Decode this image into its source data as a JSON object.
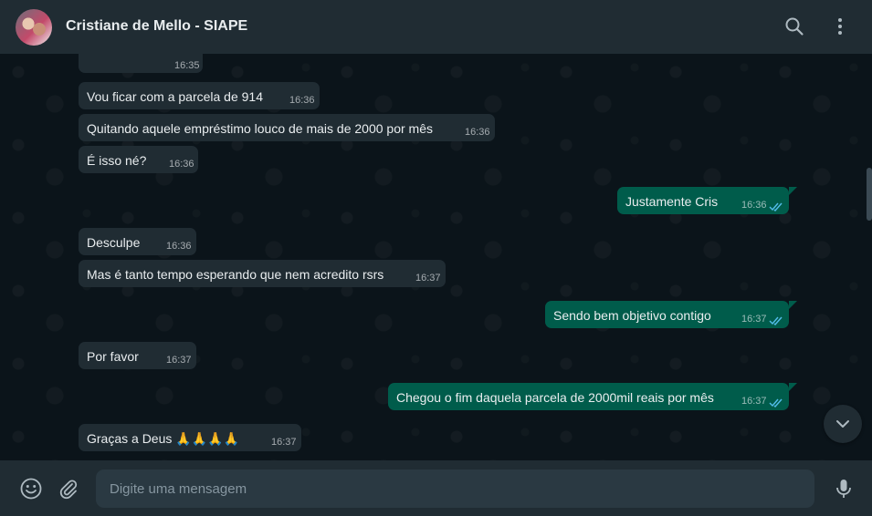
{
  "header": {
    "contact_name": "Cristiane de Mello - SIAPE",
    "icons": [
      "search-icon",
      "menu-dots-icon"
    ]
  },
  "messages": [
    {
      "dir": "in",
      "text": "",
      "time": "16:35"
    },
    {
      "dir": "in",
      "text": "Vou ficar com a parcela de 914",
      "time": "16:36"
    },
    {
      "dir": "in",
      "text": "Quitando aquele empréstimo louco de mais de 2000 por mês",
      "time": "16:36"
    },
    {
      "dir": "in",
      "text": "É isso né?",
      "time": "16:36"
    },
    {
      "dir": "out",
      "text": "Justamente Cris",
      "time": "16:36",
      "status": "read"
    },
    {
      "dir": "in",
      "text": "Desculpe",
      "time": "16:36"
    },
    {
      "dir": "in",
      "text": "Mas é tanto tempo esperando que nem acredito rsrs",
      "time": "16:37"
    },
    {
      "dir": "out",
      "text": "Sendo bem objetivo contigo",
      "time": "16:37",
      "status": "read"
    },
    {
      "dir": "in",
      "text": "Por favor",
      "time": "16:37"
    },
    {
      "dir": "out",
      "text": "Chegou o fim daquela parcela de 2000mil reais por mês",
      "time": "16:37",
      "status": "read"
    },
    {
      "dir": "in",
      "text": "Graças a Deus 🙏🙏🙏🙏",
      "time": "16:37"
    }
  ],
  "composer": {
    "placeholder": "Digite uma mensagem",
    "value": ""
  },
  "colors": {
    "incoming_bubble": "#202c33",
    "outgoing_bubble": "#005c4b",
    "read_ticks": "#53bdeb",
    "background": "#0b141a"
  }
}
